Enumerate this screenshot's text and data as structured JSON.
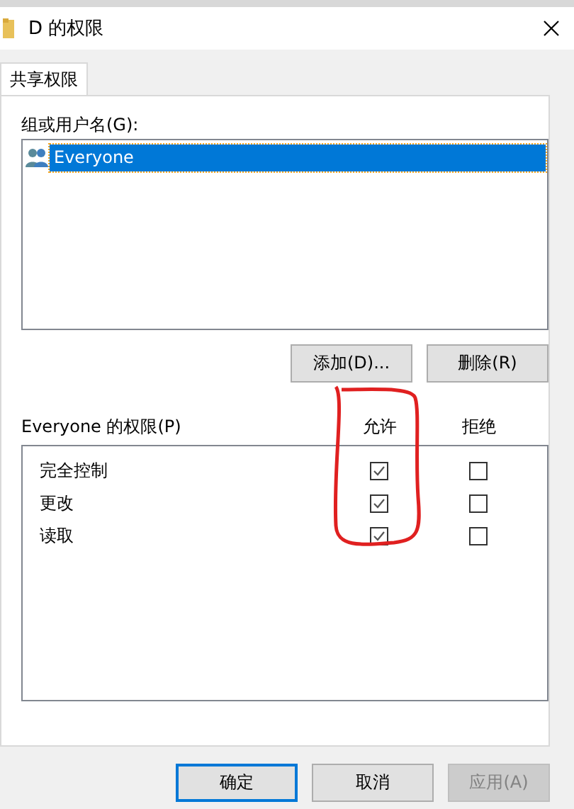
{
  "window": {
    "title": "D 的权限"
  },
  "tabs": [
    {
      "label": "共享权限",
      "selected": true
    }
  ],
  "groups": {
    "label": "组或用户名(G):",
    "items": [
      {
        "name": "Everyone",
        "selected": true
      }
    ]
  },
  "group_buttons": [
    {
      "label": "添加(D)..."
    },
    {
      "label": "删除(R)"
    }
  ],
  "permissions": {
    "label": "Everyone 的权限(P)",
    "columns": [
      "允许",
      "拒绝"
    ],
    "rows": [
      {
        "name": "完全控制",
        "allow": true,
        "deny": false
      },
      {
        "name": "更改",
        "allow": true,
        "deny": false
      },
      {
        "name": "读取",
        "allow": true,
        "deny": false
      }
    ]
  },
  "footer_buttons": [
    {
      "label": "确定",
      "default": true,
      "disabled": false
    },
    {
      "label": "取消",
      "default": false,
      "disabled": false
    },
    {
      "label": "应用(A)",
      "default": false,
      "disabled": true
    }
  ]
}
